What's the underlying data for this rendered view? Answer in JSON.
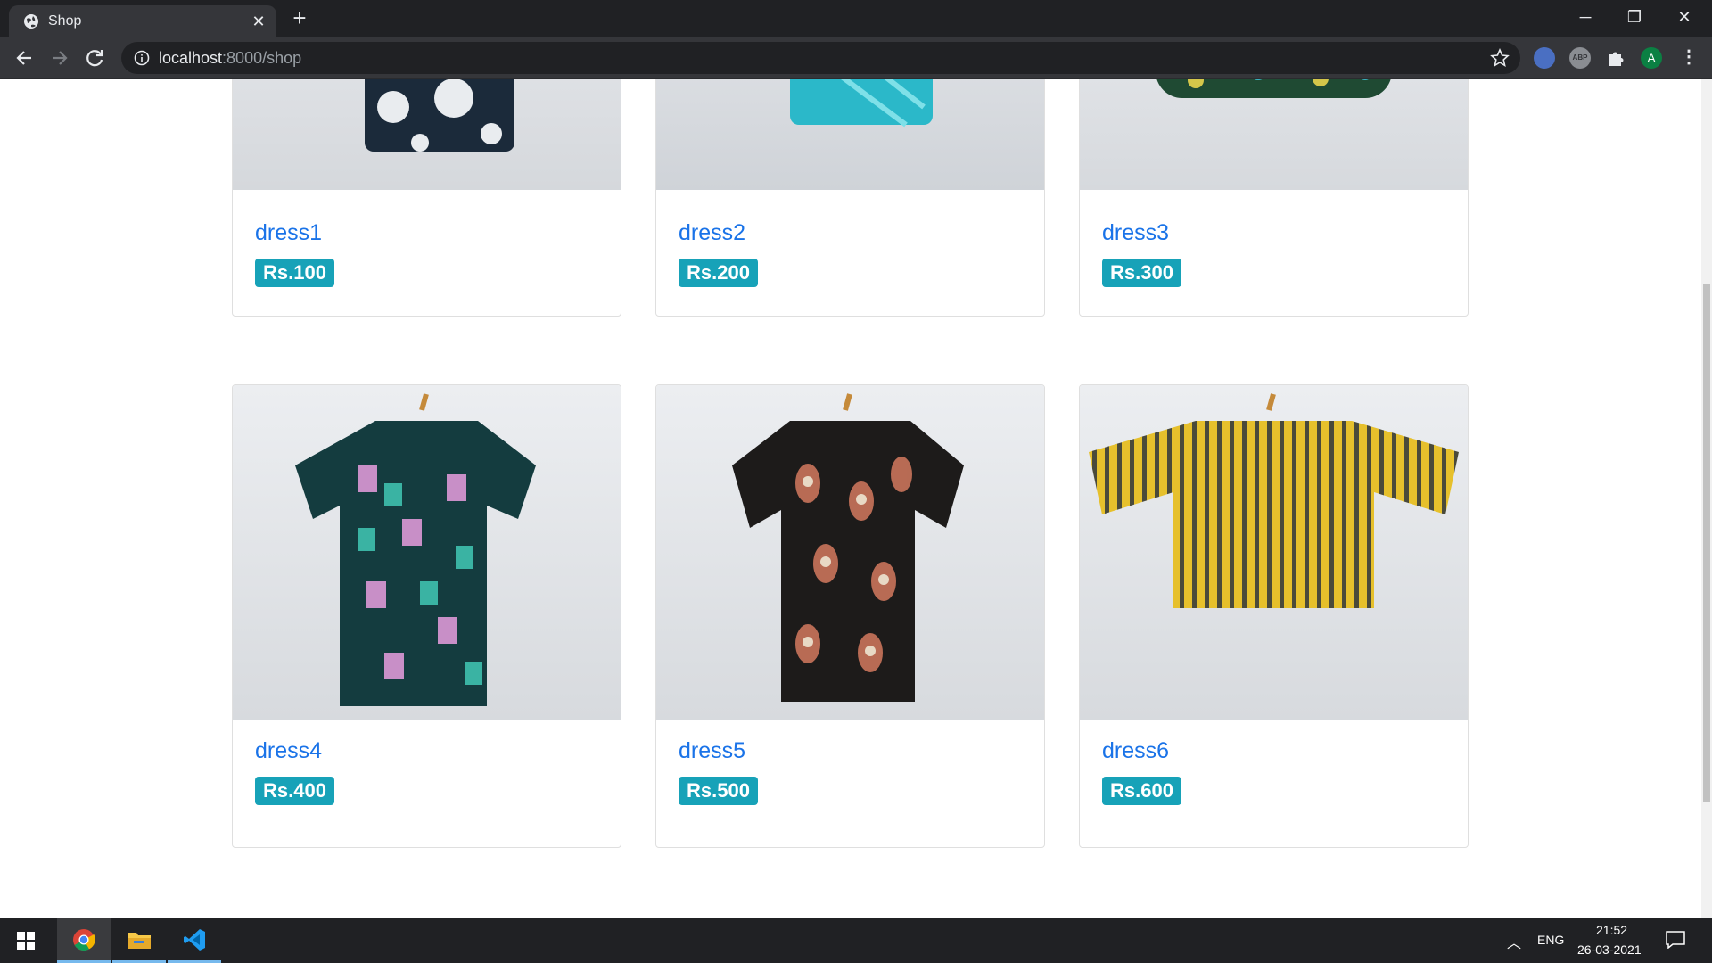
{
  "browser": {
    "tab_title": "Shop",
    "url_host": "localhost",
    "url_path": ":8000/shop",
    "profile_initial": "A"
  },
  "products": [
    {
      "name": "dress1",
      "price": "Rs.100"
    },
    {
      "name": "dress2",
      "price": "Rs.200"
    },
    {
      "name": "dress3",
      "price": "Rs.300"
    },
    {
      "name": "dress4",
      "price": "Rs.400"
    },
    {
      "name": "dress5",
      "price": "Rs.500"
    },
    {
      "name": "dress6",
      "price": "Rs.600"
    }
  ],
  "taskbar": {
    "language": "ENG",
    "time": "21:52",
    "date": "26-03-2021"
  },
  "colors": {
    "link": "#1a73e8",
    "badge": "#17a2b8",
    "chrome_dark": "#202124"
  }
}
